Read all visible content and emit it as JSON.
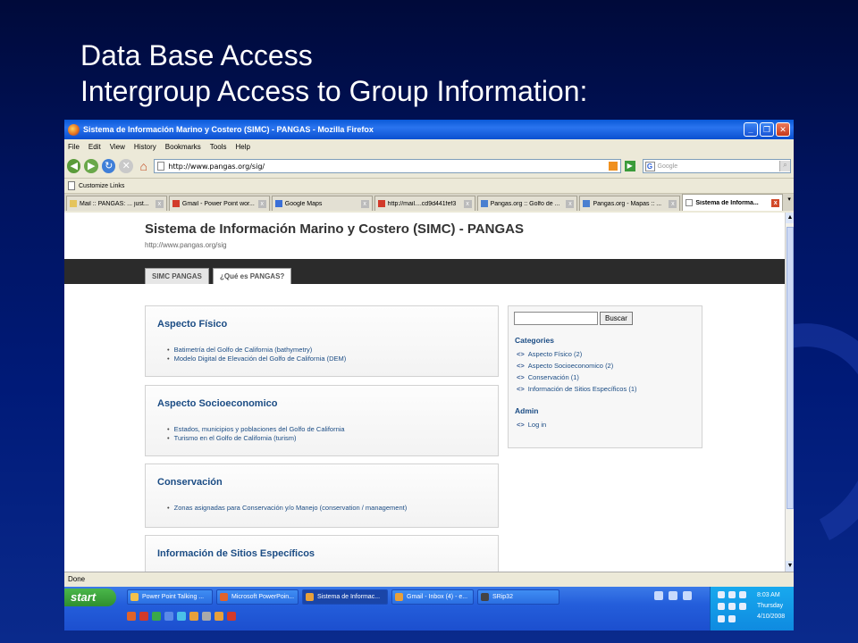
{
  "slide": {
    "title_line1": "Data Base Access",
    "title_line2": "Intergroup Access to Group Information:"
  },
  "browser": {
    "window_title": "Sistema de Información Marino y Costero (SIMC) - PANGAS - Mozilla Firefox",
    "menu": [
      "File",
      "Edit",
      "View",
      "History",
      "Bookmarks",
      "Tools",
      "Help"
    ],
    "url": "http://www.pangas.org/sig/",
    "search_placeholder": "Google",
    "bookmarks": [
      "Customize Links"
    ],
    "tabs": [
      {
        "label": "Mail :: PANGAS: ... just..."
      },
      {
        "label": "Gmail - Power Point wor..."
      },
      {
        "label": "Google Maps"
      },
      {
        "label": "http://mail....cd9d441fef3"
      },
      {
        "label": "Pangas.org :: Golfo de ..."
      },
      {
        "label": "Pangas.org - Mapas :: ..."
      },
      {
        "label": "Sistema de Informa..."
      }
    ],
    "status": "Done"
  },
  "site": {
    "title": "Sistema de Información Marino y Costero (SIMC) - PANGAS",
    "url": "http://www.pangas.org/sig",
    "nav_tabs": [
      "SIMC PANGAS",
      "¿Qué es PANGAS?"
    ],
    "panels": [
      {
        "title": "Aspecto Físico",
        "items": [
          "Batimetría del Golfo de California (bathymetry)",
          "Modelo Digital de Elevación del Golfo de California (DEM)"
        ]
      },
      {
        "title": "Aspecto Socioeconomico",
        "items": [
          "Estados, municipios y poblaciones del Golfo de California",
          "Turismo en el Golfo de California (turism)"
        ]
      },
      {
        "title": "Conservación",
        "items": [
          "Zonas asignadas para Conservación y/o Manejo (conservation / management)"
        ]
      },
      {
        "title": "Información de Sitios Específicos",
        "items": []
      }
    ],
    "sidebar": {
      "search_button": "Buscar",
      "categories_heading": "Categories",
      "categories": [
        "Aspecto Físico (2)",
        "Aspecto Socioeconomico (2)",
        "Conservación (1)",
        "Información de Sitios Específicos (1)"
      ],
      "admin_heading": "Admin",
      "admin_links": [
        "Log in"
      ]
    }
  },
  "taskbar": {
    "start": "start",
    "tasks": [
      "Power Point Talking ...",
      "Microsoft PowerPoin...",
      "Sistema de Informac...",
      "Gmail - Inbox (4) - e...",
      "SRip32"
    ],
    "active_task": 2,
    "clock": {
      "time": "8:03 AM",
      "day": "Thursday",
      "date": "4/10/2008"
    }
  }
}
